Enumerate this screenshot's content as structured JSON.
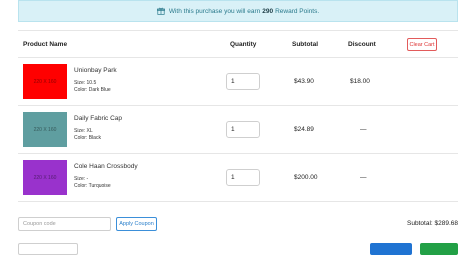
{
  "notice": {
    "prefix": "With this purchase you will earn",
    "points": "290",
    "suffix": "Reward Points."
  },
  "table": {
    "headers": {
      "product": "Product Name",
      "quantity": "Quantity",
      "subtotal": "Subtotal",
      "discount": "Discount"
    },
    "clear_label": "Clear Cart",
    "rows": [
      {
        "thumb_label": "220 X 160",
        "thumb_color": "#ff0000",
        "name": "Unionbay Park",
        "size": "Size: 10.5",
        "color": "Color: Dark Blue",
        "qty": "1",
        "subtotal": "$43.90",
        "discount": "$18.00"
      },
      {
        "thumb_label": "220 X 160",
        "thumb_color": "#5f9ea0",
        "name": "Daily Fabric Cap",
        "size": "Size: XL",
        "color": "Color: Black",
        "qty": "1",
        "subtotal": "$24.89",
        "discount": "—"
      },
      {
        "thumb_label": "220 X 160",
        "thumb_color": "#9932cc",
        "name": "Cole Haan Crossbody",
        "size": "Size: -",
        "color": "Color: Turquoise",
        "qty": "1",
        "subtotal": "$200.00",
        "discount": "—"
      }
    ]
  },
  "footer": {
    "coupon_placeholder": "Coupon code",
    "apply_label": "Apply Coupon",
    "cart_subtotal": "Subtotal: $289.68"
  },
  "colors": {
    "notice_bg": "#d9f1f7",
    "apply_blue": "#3b8fd9",
    "clear_red": "#e25b5b",
    "primary_blue": "#1f73d2",
    "success_green": "#22a046"
  }
}
